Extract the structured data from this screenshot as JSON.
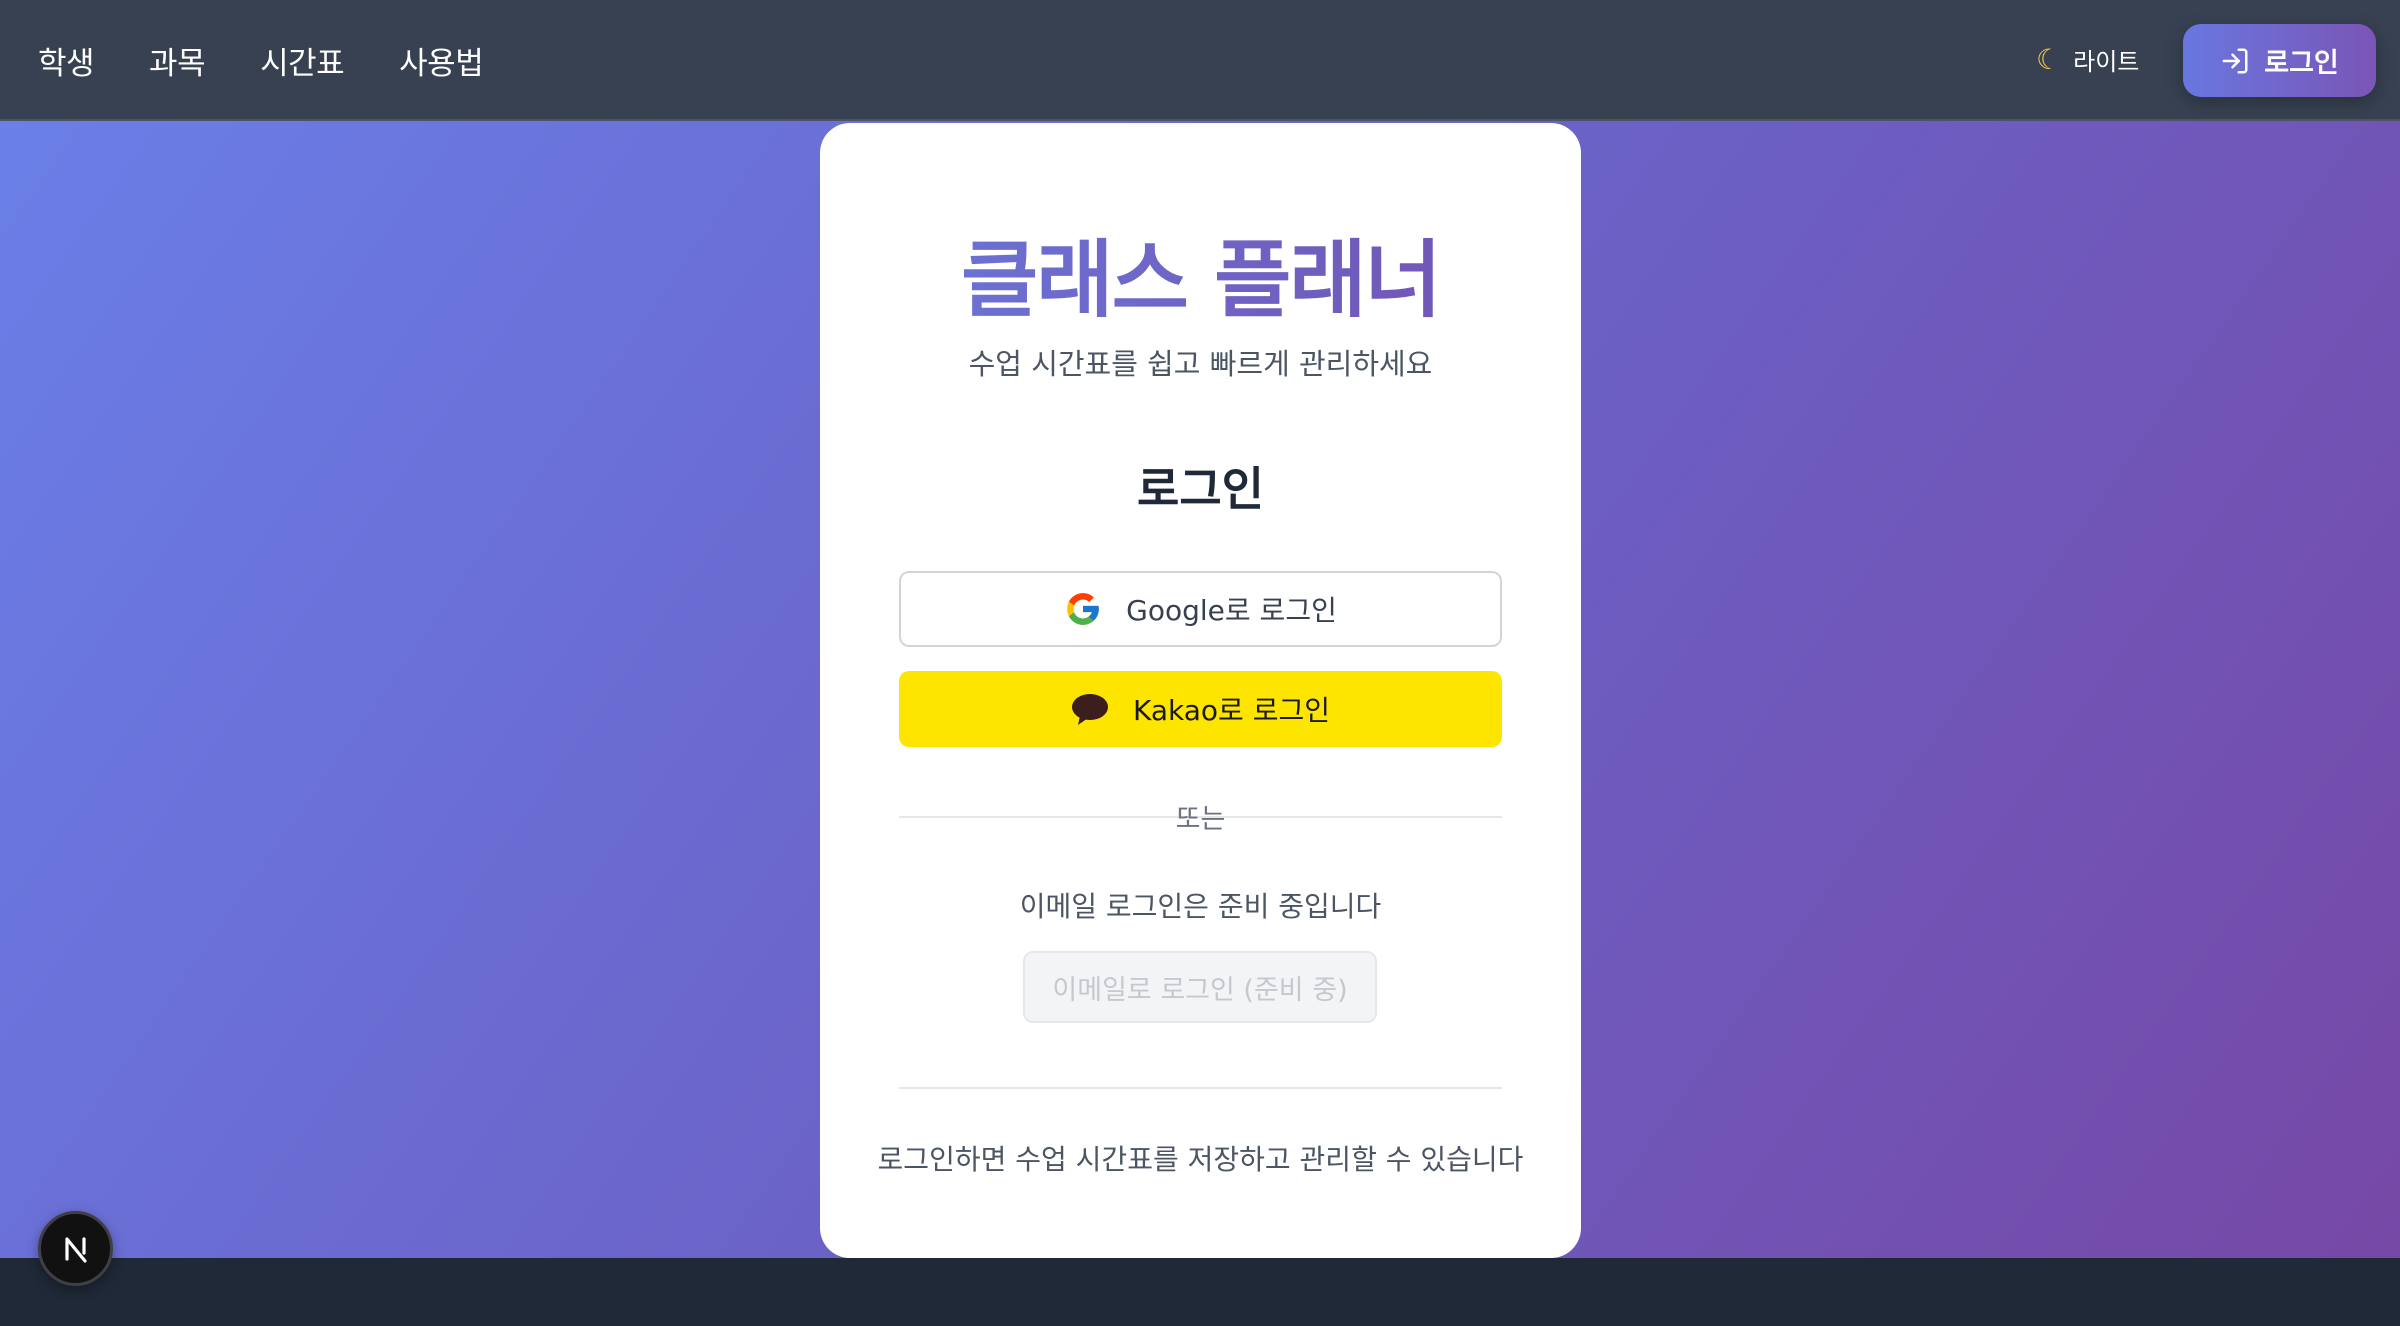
{
  "nav": {
    "links": [
      "학생",
      "과목",
      "시간표",
      "사용법"
    ],
    "theme_icon": "moon-icon",
    "theme_label": "라이트",
    "login_icon": "sign-in-icon",
    "login_label": "로그인"
  },
  "card": {
    "title": "클래스 플래너",
    "subtitle": "수업 시간표를 쉽고 빠르게 관리하세요",
    "heading": "로그인",
    "google_label": "Google로 로그인",
    "google_icon": "google-logo-icon",
    "kakao_label": "Kakao로 로그인",
    "kakao_icon": "kakao-chat-icon",
    "kakao_color": "#FEE500",
    "divider_text": "또는",
    "email_note": "이메일 로그인은 준비 중입니다",
    "email_button_label": "이메일로 로그인 (준비 중)",
    "footer_note": "로그인하면 수업 시간표를 저장하고 관리할 수 있습니다"
  },
  "dev_badge": {
    "icon": "nextjs-logo-icon"
  },
  "colors": {
    "accent_start": "#6A78DA",
    "accent_end": "#7350B0",
    "navbar": "#374151"
  }
}
